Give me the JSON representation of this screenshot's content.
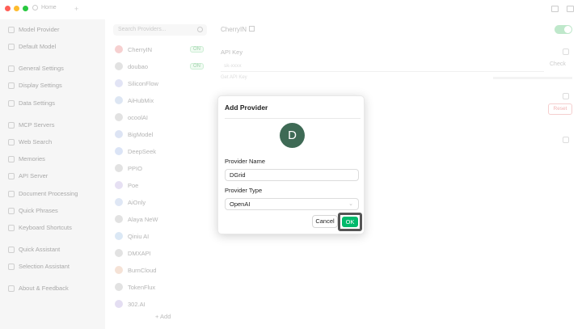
{
  "colors": {
    "accent": "#00b96b",
    "avatar_bg": "#3e6a55",
    "close": "#ff5f57",
    "minimize": "#febc2e",
    "maximize": "#28c840"
  },
  "titlebar": {
    "tab_label": "Home",
    "add_tab": "+"
  },
  "sidebar": {
    "items": [
      {
        "label": "Model Provider",
        "icon": "cloud-icon"
      },
      {
        "label": "Default Model",
        "icon": "cube-icon"
      },
      {
        "label": "General Settings",
        "icon": "gear-icon"
      },
      {
        "label": "Display Settings",
        "icon": "monitor-icon"
      },
      {
        "label": "Data Settings",
        "icon": "database-icon"
      },
      {
        "label": "MCP Servers",
        "icon": "server-icon"
      },
      {
        "label": "Web Search",
        "icon": "globe-icon"
      },
      {
        "label": "Memories",
        "icon": "brain-icon"
      },
      {
        "label": "API Server",
        "icon": "api-icon"
      },
      {
        "label": "Document Processing",
        "icon": "document-icon"
      },
      {
        "label": "Quick Phrases",
        "icon": "zap-icon"
      },
      {
        "label": "Keyboard Shortcuts",
        "icon": "keyboard-icon"
      },
      {
        "label": "Quick Assistant",
        "icon": "assistant-icon"
      },
      {
        "label": "Selection Assistant",
        "icon": "selection-icon"
      },
      {
        "label": "About & Feedback",
        "icon": "info-icon"
      }
    ]
  },
  "providers": {
    "search_placeholder": "Search Providers...",
    "items": [
      {
        "name": "CherryIN",
        "badge": "ON"
      },
      {
        "name": "doubao",
        "badge": "ON"
      },
      {
        "name": "SiliconFlow",
        "badge": ""
      },
      {
        "name": "AiHubMix",
        "badge": ""
      },
      {
        "name": "ocoolAI",
        "badge": ""
      },
      {
        "name": "BigModel",
        "badge": ""
      },
      {
        "name": "DeepSeek",
        "badge": ""
      },
      {
        "name": "PPIO",
        "badge": ""
      },
      {
        "name": "Poe",
        "badge": ""
      },
      {
        "name": "AiOnly",
        "badge": ""
      },
      {
        "name": "Alaya NeW",
        "badge": ""
      },
      {
        "name": "Qiniu AI",
        "badge": ""
      },
      {
        "name": "DMXAPI",
        "badge": ""
      },
      {
        "name": "BurnCloud",
        "badge": ""
      },
      {
        "name": "TokenFlux",
        "badge": ""
      },
      {
        "name": "302.AI",
        "badge": ""
      }
    ],
    "add_label": "+ Add"
  },
  "main": {
    "title": "CherryIN",
    "api_key_label": "API Key",
    "api_key_placeholder": "sk-xxxx",
    "check_label": "Check",
    "hint": "Get API Key",
    "reset_label": "Reset"
  },
  "modal": {
    "title": "Add Provider",
    "avatar_letter": "D",
    "name_label": "Provider Name",
    "name_value": "DGrid",
    "type_label": "Provider Type",
    "type_value": "OpenAI",
    "cancel_label": "Cancel",
    "ok_label": "OK"
  }
}
